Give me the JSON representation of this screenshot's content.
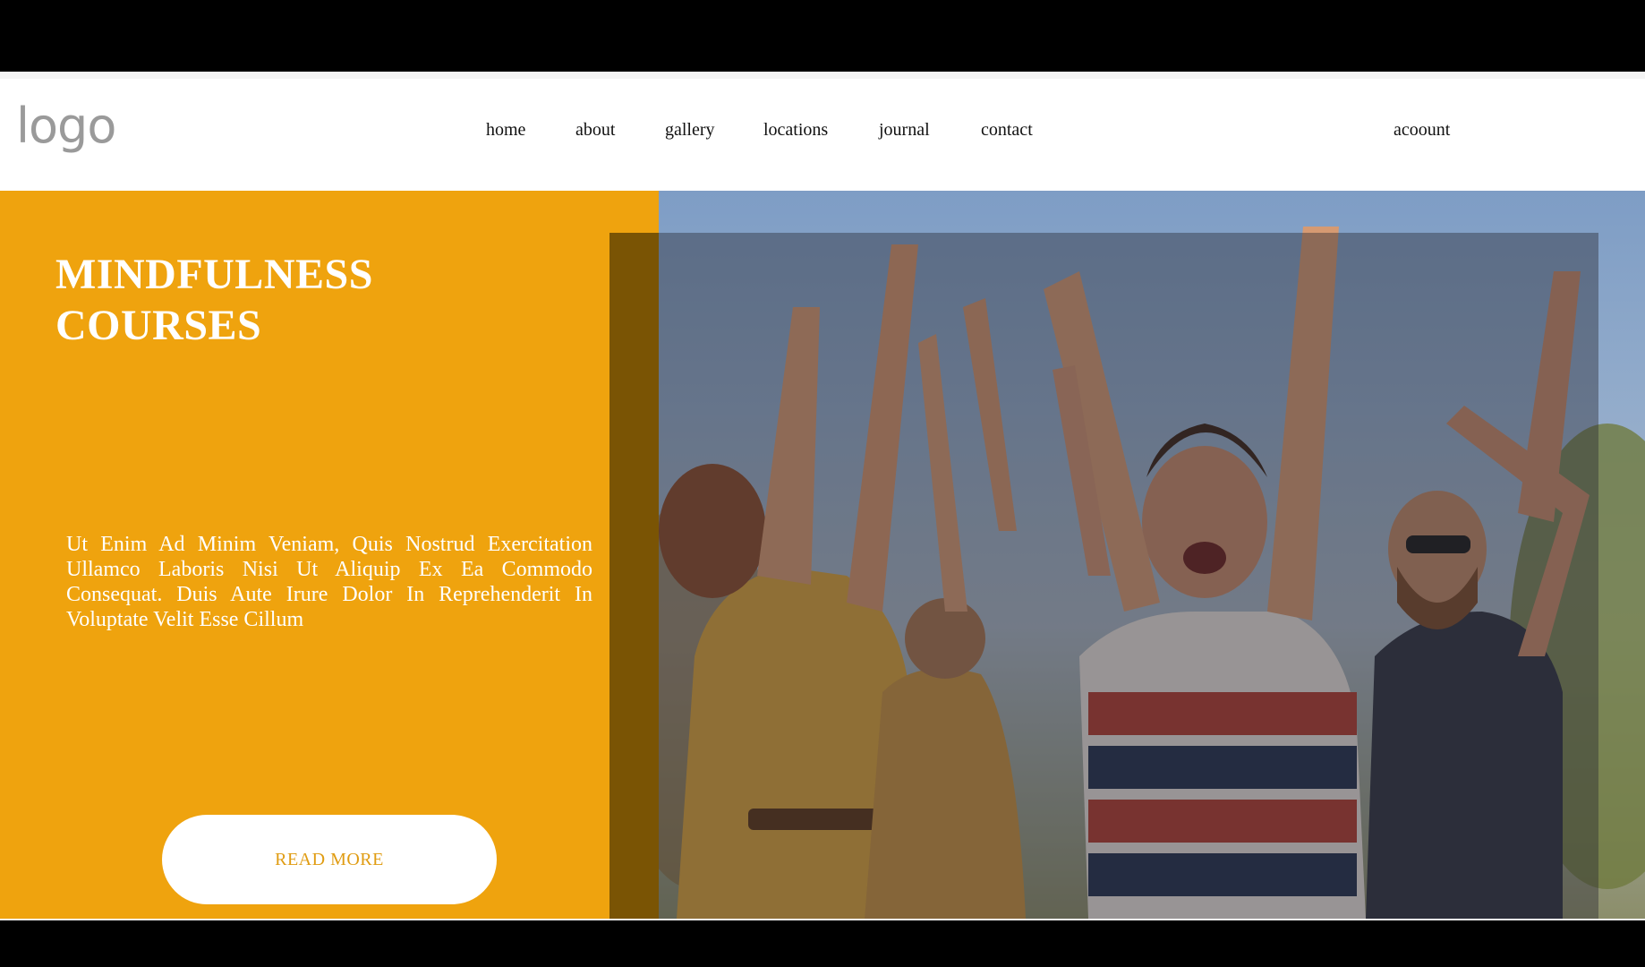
{
  "header": {
    "logo_text": "logo",
    "nav": [
      {
        "label": "home"
      },
      {
        "label": "about"
      },
      {
        "label": "gallery"
      },
      {
        "label": "locations"
      },
      {
        "label": "journal"
      },
      {
        "label": "contact"
      }
    ],
    "account_label": "acoount"
  },
  "hero": {
    "title_line1": "MINDFULNESS",
    "title_line2": "COURSES",
    "description": "Ut Enim Ad Minim Veniam, Quis Nostrud Exercitation Ullamco Laboris Nisi Ut Aliquip Ex Ea Commodo Consequat. Duis Aute Irure Dolor In Reprehenderit In Voluptate Velit Esse Cillum",
    "button_label": "READ MORE",
    "photo_icon": "group-celebration-photo"
  },
  "colors": {
    "accent": "#efa30e",
    "button_text": "#e09c12",
    "overlay_band": "#7a5404"
  }
}
